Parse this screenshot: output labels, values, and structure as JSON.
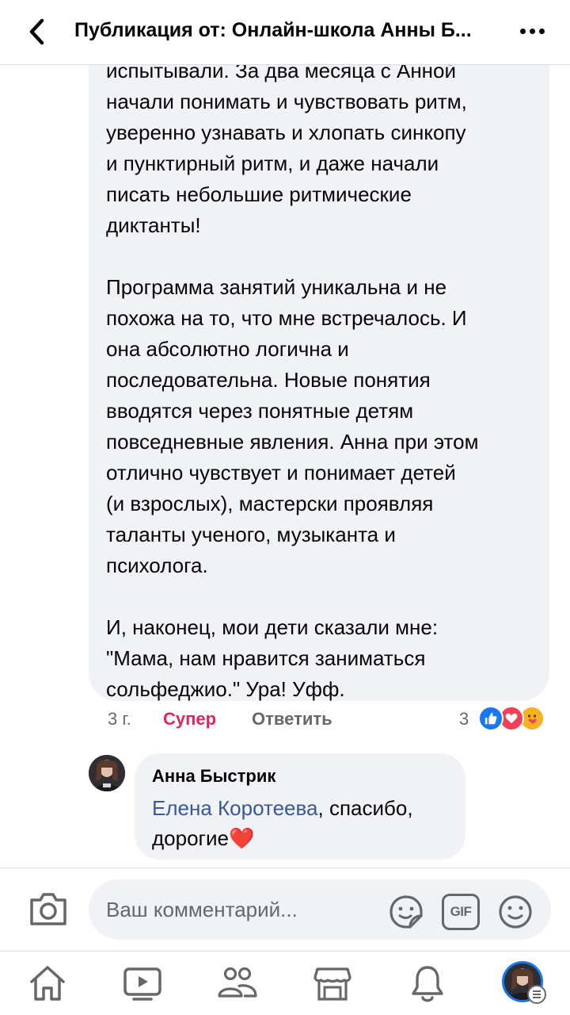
{
  "header": {
    "title": "Публикация от: Онлайн-школа Анны Б...",
    "back_icon": "chevron-left-icon",
    "more_icon": "more-dots-icon"
  },
  "comment": {
    "text": "испытывали. За два месяца с Анной\nначали понимать и чувствовать ритм,\nуверенно узнавать и хлопать синкопу\nи пунктирный ритм, и даже начали\nписать небольшие ритмические\nдиктанты!\n\nПрограмма занятий уникальна и не\nпохожа на то, что мне встречалось. И\nона абсолютно логична и\nпоследовательна. Новые понятия\nвводятся через понятные детям\nповседневные явления. Анна при этом\nотлично чувствует и понимает детей\n(и взрослых),  мастерски проявляя\nталанты ученого, музыканта и\nпсихолога.\n\nИ, наконец, мои дети сказали мне:\n\"Мама, нам нравится заниматься\nсольфеджио.\" Ура! Уфф.",
    "time": "3 г.",
    "reaction_label": "Супер",
    "reply_label": "Ответить",
    "reaction_count": "3",
    "reactions": [
      "like",
      "love",
      "care"
    ]
  },
  "reply": {
    "author": "Анна Быстрик",
    "mention": "Елена Коротеева",
    "text": ", спасибо, дорогие",
    "emoji": "❤️"
  },
  "composer": {
    "placeholder": "Ваш комментарий...",
    "gif_label": "GIF"
  },
  "colors": {
    "accent_blue": "#1877f2",
    "mention_blue": "#385898",
    "super_pink": "#e0245e",
    "bubble_gray": "#f0f2f5",
    "secondary_text": "#65676b"
  },
  "tabbar": {
    "items": [
      "home-icon",
      "video-icon",
      "friends-icon",
      "marketplace-icon",
      "notifications-icon",
      "profile-menu-icon"
    ]
  }
}
